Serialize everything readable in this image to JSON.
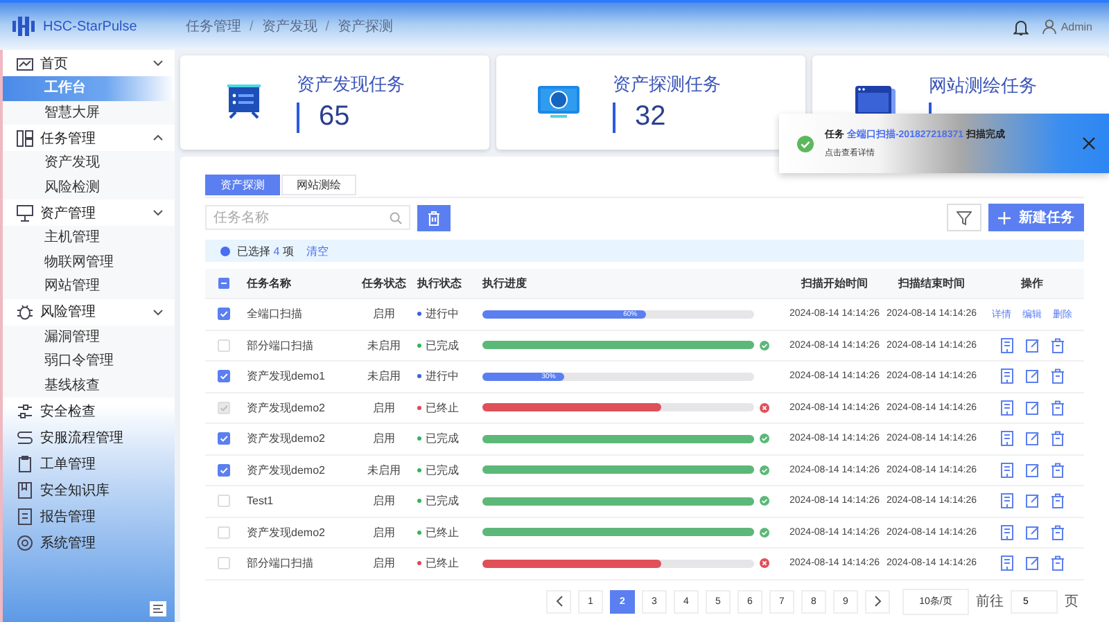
{
  "header": {
    "logo_text": "HSC-StarPulse",
    "breadcrumb": [
      "任务管理",
      "资产发现",
      "资产探测"
    ],
    "breadcrumb_separators": [
      "/",
      "/"
    ],
    "user": "Admin"
  },
  "sidebar": {
    "items": [
      {
        "label": "首页",
        "expanded": false,
        "children": [
          {
            "label": "工作台",
            "selected": true
          },
          {
            "label": "智慧大屏",
            "selected": false
          }
        ]
      },
      {
        "label": "任务管理",
        "expanded": true,
        "children": [
          {
            "label": "资产发现",
            "selected": false
          },
          {
            "label": "风险检测",
            "selected": false
          }
        ]
      },
      {
        "label": "资产管理",
        "expanded": false,
        "children": [
          {
            "label": "主机管理",
            "selected": false
          },
          {
            "label": "物联网管理",
            "selected": false
          },
          {
            "label": "网站管理",
            "selected": false
          }
        ]
      },
      {
        "label": "风险管理",
        "expanded": false,
        "children": [
          {
            "label": "漏洞管理",
            "selected": false
          },
          {
            "label": "弱口令管理",
            "selected": false
          },
          {
            "label": "基线核查",
            "selected": false
          }
        ]
      },
      {
        "label": "安全检查"
      },
      {
        "label": "安服流程管理"
      },
      {
        "label": "工单管理"
      },
      {
        "label": "安全知识库"
      },
      {
        "label": "报告管理"
      },
      {
        "label": "系统管理"
      }
    ]
  },
  "stats": [
    {
      "title": "资产发现任务",
      "value": "65"
    },
    {
      "title": "资产探测任务",
      "value": "32"
    },
    {
      "title": "网站测绘任务"
    }
  ],
  "toast": {
    "prefix": "任务",
    "link": "全端口扫描-201827218371",
    "suffix": "扫描完成",
    "detail": "点击查看详情"
  },
  "tabs": [
    {
      "label": "资产探测",
      "selected": true
    },
    {
      "label": "网站测绘",
      "selected": false
    }
  ],
  "search": {
    "placeholder": "任务名称"
  },
  "new_button": "新建任务",
  "selection": {
    "prefix": "已选择",
    "count": "4",
    "unit": "项",
    "clear": "清空"
  },
  "table": {
    "select_all_partial": true,
    "columns": [
      "任务名称",
      "任务状态",
      "执行状态",
      "执行进度",
      "扫描开始时间",
      "扫描结束时间",
      "操作"
    ],
    "rows": [
      {
        "kind": "running",
        "checked": true,
        "disabled": false,
        "name": "全端口扫描",
        "state": "启用",
        "status": "进行中",
        "color": "#3a63e0",
        "level": 0.6,
        "progress_label": "60%",
        "actions": [
          "详情",
          "编辑",
          "删除"
        ]
      },
      {
        "kind": "success",
        "checked": false,
        "disabled": false,
        "name": "部分端口扫描",
        "state": "未启用",
        "status": "已完成",
        "color": "#35b45a",
        "level": 1
      },
      {
        "kind": "running",
        "checked": true,
        "disabled": false,
        "name": "资产发现demo1",
        "state": "未启用",
        "status": "进行中",
        "color": "#3a63e0",
        "level": 0.3,
        "progress_label": "30%"
      },
      {
        "kind": "failure",
        "checked": true,
        "disabled": true,
        "name": "资产发现demo2",
        "state": "启用",
        "status": "已终止",
        "color": "#e04850",
        "level": 0.66
      },
      {
        "kind": "success",
        "checked": true,
        "disabled": false,
        "name": "资产发现demo2",
        "state": "启用",
        "status": "已完成",
        "color": "#35b45a",
        "level": 1
      },
      {
        "kind": "success",
        "checked": true,
        "disabled": false,
        "name": "资产发现demo2",
        "state": "未启用",
        "status": "已完成",
        "color": "#35b45a",
        "level": 1
      },
      {
        "kind": "success",
        "checked": false,
        "disabled": false,
        "name": "Test1",
        "state": "启用",
        "status": "已完成",
        "color": "#35b45a",
        "level": 1
      },
      {
        "kind": "success",
        "checked": false,
        "disabled": false,
        "name": "资产发现demo2",
        "state": "启用",
        "status": "已终止",
        "color": "#35b45a",
        "level": 1
      },
      {
        "kind": "failure",
        "checked": false,
        "disabled": false,
        "name": "部分端口扫描",
        "state": "启用",
        "status": "已终止",
        "color": "#e04850",
        "level": 0.66
      }
    ],
    "start_times": [
      "2024-08-14 14:14:26",
      "2024-08-14 14:14:26",
      "2024-08-14 14:14:26",
      "2024-08-14 14:14:26",
      "2024-08-14 14:14:26",
      "2024-08-14 14:14:26",
      "2024-08-14 14:14:26",
      "2024-08-14 14:14:26",
      "2024-08-14 14:14:26"
    ],
    "end_times": [
      "2024-08-14 14:14:26",
      "2024-08-14 14:14:26",
      "2024-08-14 14:14:26",
      "2024-08-14 14:14:26",
      "2024-08-14 14:14:26",
      "2024-08-14 14:14:26",
      "2024-08-14 14:14:26",
      "2024-08-14 14:14:26",
      "2024-08-14 14:14:26"
    ]
  },
  "pagination": {
    "pages": [
      {
        "label": "1",
        "selected": false
      },
      {
        "label": "2",
        "selected": true
      },
      {
        "label": "3",
        "selected": false
      },
      {
        "label": "4",
        "selected": false
      },
      {
        "label": "5",
        "selected": false
      },
      {
        "label": "6",
        "selected": false
      },
      {
        "label": "7",
        "selected": false
      },
      {
        "label": "8",
        "selected": false
      },
      {
        "label": "9",
        "selected": false
      }
    ],
    "page_size": "10条/页",
    "goto": "前往",
    "goto_value": "5",
    "page_unit": "页"
  }
}
